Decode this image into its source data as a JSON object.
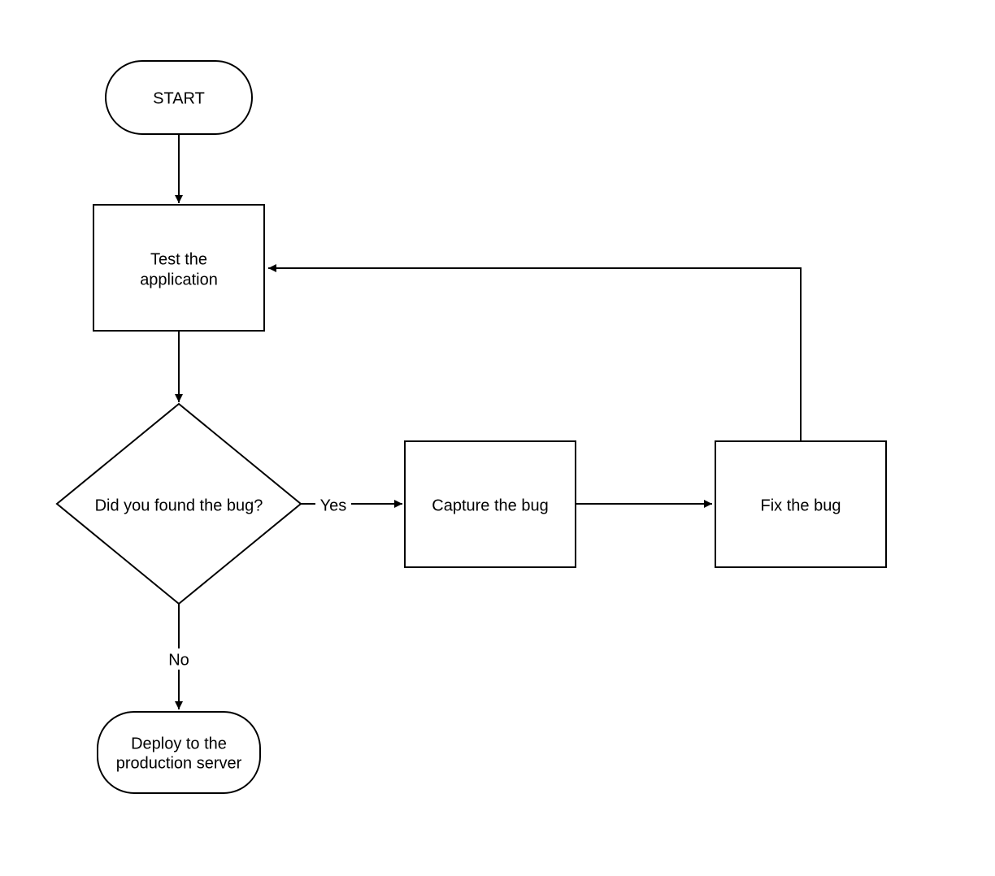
{
  "flowchart": {
    "nodes": {
      "start": {
        "label": "START",
        "type": "terminator"
      },
      "test": {
        "label1": "Test the",
        "label2": "application",
        "type": "process"
      },
      "decision": {
        "label": "Did you found the bug?",
        "type": "decision"
      },
      "capture": {
        "label": "Capture the bug",
        "type": "process"
      },
      "fix": {
        "label": "Fix the bug",
        "type": "process"
      },
      "deploy": {
        "label1": "Deploy to the",
        "label2": "production server",
        "type": "terminator"
      }
    },
    "edges": {
      "start_to_test": {
        "from": "start",
        "to": "test"
      },
      "test_to_decision": {
        "from": "test",
        "to": "decision"
      },
      "decision_yes": {
        "from": "decision",
        "to": "capture",
        "label": "Yes"
      },
      "decision_no": {
        "from": "decision",
        "to": "deploy",
        "label": "No"
      },
      "capture_to_fix": {
        "from": "capture",
        "to": "fix"
      },
      "fix_to_test": {
        "from": "fix",
        "to": "test"
      }
    }
  },
  "chart_data": {
    "type": "flowchart",
    "title": "",
    "nodes": [
      {
        "id": "start",
        "shape": "terminator",
        "text": "START"
      },
      {
        "id": "test",
        "shape": "process",
        "text": "Test the application"
      },
      {
        "id": "decision",
        "shape": "decision",
        "text": "Did you found the bug?"
      },
      {
        "id": "capture",
        "shape": "process",
        "text": "Capture the bug"
      },
      {
        "id": "fix",
        "shape": "process",
        "text": "Fix the bug"
      },
      {
        "id": "deploy",
        "shape": "terminator",
        "text": "Deploy to the production server"
      }
    ],
    "edges": [
      {
        "from": "start",
        "to": "test",
        "label": ""
      },
      {
        "from": "test",
        "to": "decision",
        "label": ""
      },
      {
        "from": "decision",
        "to": "capture",
        "label": "Yes"
      },
      {
        "from": "decision",
        "to": "deploy",
        "label": "No"
      },
      {
        "from": "capture",
        "to": "fix",
        "label": ""
      },
      {
        "from": "fix",
        "to": "test",
        "label": ""
      }
    ]
  }
}
